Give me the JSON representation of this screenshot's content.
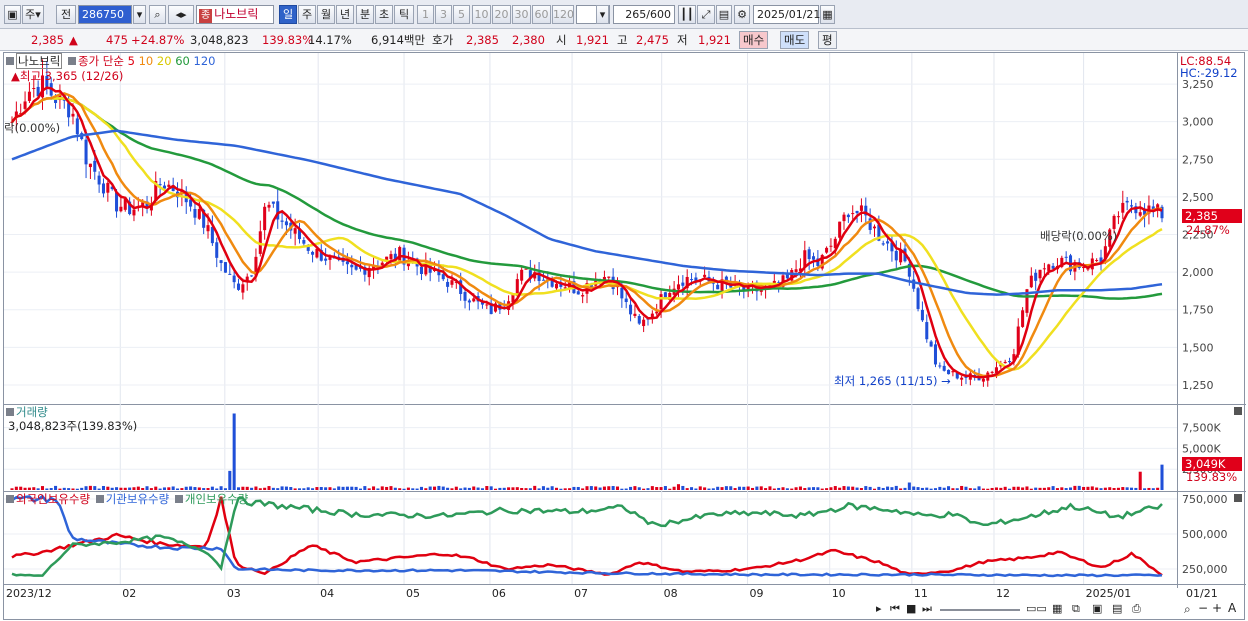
{
  "toolbar": {
    "period_label": "주",
    "prev_label": "전",
    "code": "286750",
    "name_badge": "종",
    "name": "나노브릭",
    "periods": [
      "일",
      "주",
      "월",
      "년",
      "분",
      "초",
      "틱"
    ],
    "active_period": "일",
    "intervals": [
      "1",
      "3",
      "5",
      "10",
      "20",
      "30",
      "60",
      "120"
    ],
    "count": "265",
    "count_total": "/600",
    "date": "2025/01/21"
  },
  "quote": {
    "price": "2,385",
    "change": "475",
    "change_pct": "+24.87%",
    "volume": "3,048,823",
    "vol_ratio": "139.83%",
    "turnover": "14.17%",
    "amount": "6,914백만",
    "hoga_label": "호가",
    "ask": "2,385",
    "bid": "2,380",
    "open_label": "시",
    "open": "1,921",
    "high_label": "고",
    "high": "2,475",
    "low_label": "저",
    "low": "1,921",
    "buy_label": "매수",
    "sell_label": "매도",
    "eval_label": "평"
  },
  "price_panel": {
    "title": "나노브릭",
    "ma_prefix": "종가 단순",
    "ma_labels": [
      "5",
      "10",
      "20",
      "60",
      "120"
    ],
    "high_note": "최고 3,365 (12/26)",
    "low_note": "최저 1,265 (11/15)",
    "exdiv_left": "락(0.00%)",
    "exdiv_right": "배당락(0.00%)",
    "lc": "LC:88.54",
    "hc": "HC:-29.12",
    "y_ticks": [
      "3,250",
      "3,000",
      "2,750",
      "2,500",
      "2,250",
      "2,000",
      "1,750",
      "1,500",
      "1,250"
    ],
    "cur_price": "2,385",
    "cur_pct": "24.87%"
  },
  "volume_panel": {
    "title": "거래량",
    "note": "3,048,823주(139.83%)",
    "y_ticks": [
      "7,500K",
      "5,000K",
      "2,500K"
    ],
    "cur_value": "3,049K",
    "cur_pct": "139.83%"
  },
  "holding_panel": {
    "series_names": [
      "외국인보유수량",
      "기관보유수량",
      "개인보유수량"
    ],
    "y_ticks": [
      "750,000",
      "500,000",
      "250,000"
    ]
  },
  "x_axis": {
    "labels": [
      "2023/12",
      "02",
      "03",
      "04",
      "05",
      "06",
      "07",
      "08",
      "09",
      "10",
      "11",
      "12",
      "2025/01",
      "01/21"
    ]
  },
  "colors": {
    "up": "#e0001a",
    "down": "#1f4fd8",
    "ma5": "#e00010",
    "ma10": "#f08a10",
    "ma20": "#f0e020",
    "ma60": "#239a3c",
    "ma120": "#2f64d8",
    "foreign": "#e00010",
    "institution": "#2f64d8",
    "individual": "#2e9a5a"
  },
  "chart_data": {
    "type": "candlestick",
    "price_ylim": [
      1130,
      3430
    ],
    "price_path": [
      [
        0,
        3000
      ],
      [
        2,
        3200
      ],
      [
        4,
        3250
      ],
      [
        6,
        3150
      ],
      [
        8,
        3080
      ],
      [
        10,
        2750
      ],
      [
        12,
        2600
      ],
      [
        14,
        2450
      ],
      [
        16,
        2420
      ],
      [
        18,
        2450
      ],
      [
        20,
        2600
      ],
      [
        22,
        2550
      ],
      [
        24,
        2450
      ],
      [
        26,
        2300
      ],
      [
        28,
        2050
      ],
      [
        30,
        1900
      ],
      [
        32,
        2000
      ],
      [
        34,
        2450
      ],
      [
        36,
        2350
      ],
      [
        38,
        2250
      ],
      [
        40,
        2150
      ],
      [
        42,
        2100
      ],
      [
        44,
        2030
      ],
      [
        46,
        2000
      ],
      [
        48,
        2050
      ],
      [
        50,
        2080
      ],
      [
        52,
        2120
      ],
      [
        54,
        2050
      ],
      [
        56,
        2000
      ],
      [
        58,
        1950
      ],
      [
        60,
        1880
      ],
      [
        62,
        1800
      ],
      [
        64,
        1740
      ],
      [
        66,
        1800
      ],
      [
        68,
        1980
      ],
      [
        70,
        2000
      ],
      [
        72,
        1950
      ],
      [
        74,
        1920
      ],
      [
        76,
        1880
      ],
      [
        78,
        1950
      ],
      [
        80,
        1980
      ],
      [
        82,
        1800
      ],
      [
        84,
        1640
      ],
      [
        86,
        1750
      ],
      [
        88,
        1900
      ],
      [
        90,
        1960
      ],
      [
        92,
        1950
      ],
      [
        94,
        1930
      ],
      [
        96,
        1900
      ],
      [
        98,
        1880
      ],
      [
        100,
        1880
      ],
      [
        102,
        1900
      ],
      [
        104,
        1950
      ],
      [
        106,
        2100
      ],
      [
        108,
        2050
      ],
      [
        110,
        2200
      ],
      [
        112,
        2420
      ],
      [
        114,
        2380
      ],
      [
        116,
        2250
      ],
      [
        118,
        2150
      ],
      [
        120,
        2050
      ],
      [
        122,
        1650
      ],
      [
        124,
        1350
      ],
      [
        126,
        1320
      ],
      [
        128,
        1300
      ],
      [
        130,
        1310
      ],
      [
        132,
        1380
      ],
      [
        134,
        1450
      ],
      [
        136,
        1900
      ],
      [
        138,
        2050
      ],
      [
        140,
        2080
      ],
      [
        142,
        2050
      ],
      [
        144,
        2050
      ],
      [
        146,
        2100
      ],
      [
        148,
        2380
      ],
      [
        150,
        2450
      ],
      [
        152,
        2420
      ],
      [
        154,
        2385
      ]
    ],
    "ma120_path": [
      [
        0,
        2750
      ],
      [
        8,
        2900
      ],
      [
        14,
        2940
      ],
      [
        22,
        2880
      ],
      [
        30,
        2840
      ],
      [
        40,
        2740
      ],
      [
        50,
        2620
      ],
      [
        60,
        2520
      ],
      [
        66,
        2380
      ],
      [
        72,
        2220
      ],
      [
        78,
        2140
      ],
      [
        84,
        2090
      ],
      [
        90,
        2040
      ],
      [
        96,
        2010
      ],
      [
        100,
        2000
      ],
      [
        104,
        1990
      ],
      [
        108,
        1980
      ],
      [
        112,
        1990
      ],
      [
        116,
        1990
      ],
      [
        120,
        1940
      ],
      [
        124,
        1900
      ],
      [
        128,
        1860
      ],
      [
        132,
        1850
      ],
      [
        136,
        1860
      ],
      [
        140,
        1880
      ],
      [
        146,
        1880
      ],
      [
        150,
        1890
      ],
      [
        154,
        1920
      ]
    ],
    "volume_ylim": [
      0,
      9500
    ],
    "volume_spikes_k": [
      {
        "x": 30,
        "v": 9200
      },
      {
        "x": 29,
        "v": 2300
      },
      {
        "x": 154,
        "v": 3049
      },
      {
        "x": 151,
        "v": 2200
      },
      {
        "x": 89,
        "v": 700
      },
      {
        "x": 120,
        "v": 900
      }
    ],
    "holdings_ylim": [
      150000,
      800000
    ],
    "series": [
      {
        "name": "외국인보유수량",
        "values": [
          [
            0,
            340000
          ],
          [
            4,
            370000
          ],
          [
            8,
            420000
          ],
          [
            14,
            490000
          ],
          [
            20,
            430000
          ],
          [
            26,
            410000
          ],
          [
            28,
            760000
          ],
          [
            30,
            280000
          ],
          [
            34,
            220000
          ],
          [
            40,
            420000
          ],
          [
            46,
            300000
          ],
          [
            52,
            330000
          ],
          [
            58,
            360000
          ],
          [
            62,
            320000
          ],
          [
            66,
            250000
          ],
          [
            72,
            280000
          ],
          [
            80,
            210000
          ],
          [
            84,
            300000
          ],
          [
            90,
            230000
          ],
          [
            96,
            240000
          ],
          [
            100,
            260000
          ],
          [
            106,
            320000
          ],
          [
            110,
            380000
          ],
          [
            116,
            300000
          ],
          [
            120,
            210000
          ],
          [
            126,
            240000
          ],
          [
            130,
            300000
          ],
          [
            136,
            330000
          ],
          [
            140,
            370000
          ],
          [
            146,
            260000
          ],
          [
            150,
            360000
          ],
          [
            154,
            210000
          ]
        ]
      },
      {
        "name": "기관보유수량",
        "values": [
          [
            0,
            750000
          ],
          [
            6,
            750000
          ],
          [
            8,
            470000
          ],
          [
            14,
            430000
          ],
          [
            22,
            400000
          ],
          [
            28,
            400000
          ],
          [
            30,
            250000
          ],
          [
            40,
            240000
          ],
          [
            60,
            240000
          ],
          [
            80,
            220000
          ],
          [
            100,
            210000
          ],
          [
            120,
            210000
          ],
          [
            140,
            205000
          ],
          [
            154,
            205000
          ]
        ]
      },
      {
        "name": "개인보유수량",
        "values": [
          [
            0,
            210000
          ],
          [
            4,
            200000
          ],
          [
            8,
            420000
          ],
          [
            14,
            440000
          ],
          [
            20,
            480000
          ],
          [
            26,
            380000
          ],
          [
            28,
            260000
          ],
          [
            30,
            740000
          ],
          [
            36,
            700000
          ],
          [
            46,
            640000
          ],
          [
            58,
            630000
          ],
          [
            66,
            670000
          ],
          [
            76,
            660000
          ],
          [
            82,
            690000
          ],
          [
            86,
            560000
          ],
          [
            94,
            640000
          ],
          [
            100,
            650000
          ],
          [
            106,
            630000
          ],
          [
            112,
            700000
          ],
          [
            118,
            670000
          ],
          [
            122,
            630000
          ],
          [
            126,
            640000
          ],
          [
            130,
            560000
          ],
          [
            136,
            620000
          ],
          [
            142,
            700000
          ],
          [
            148,
            620000
          ],
          [
            154,
            700000
          ]
        ]
      }
    ]
  }
}
